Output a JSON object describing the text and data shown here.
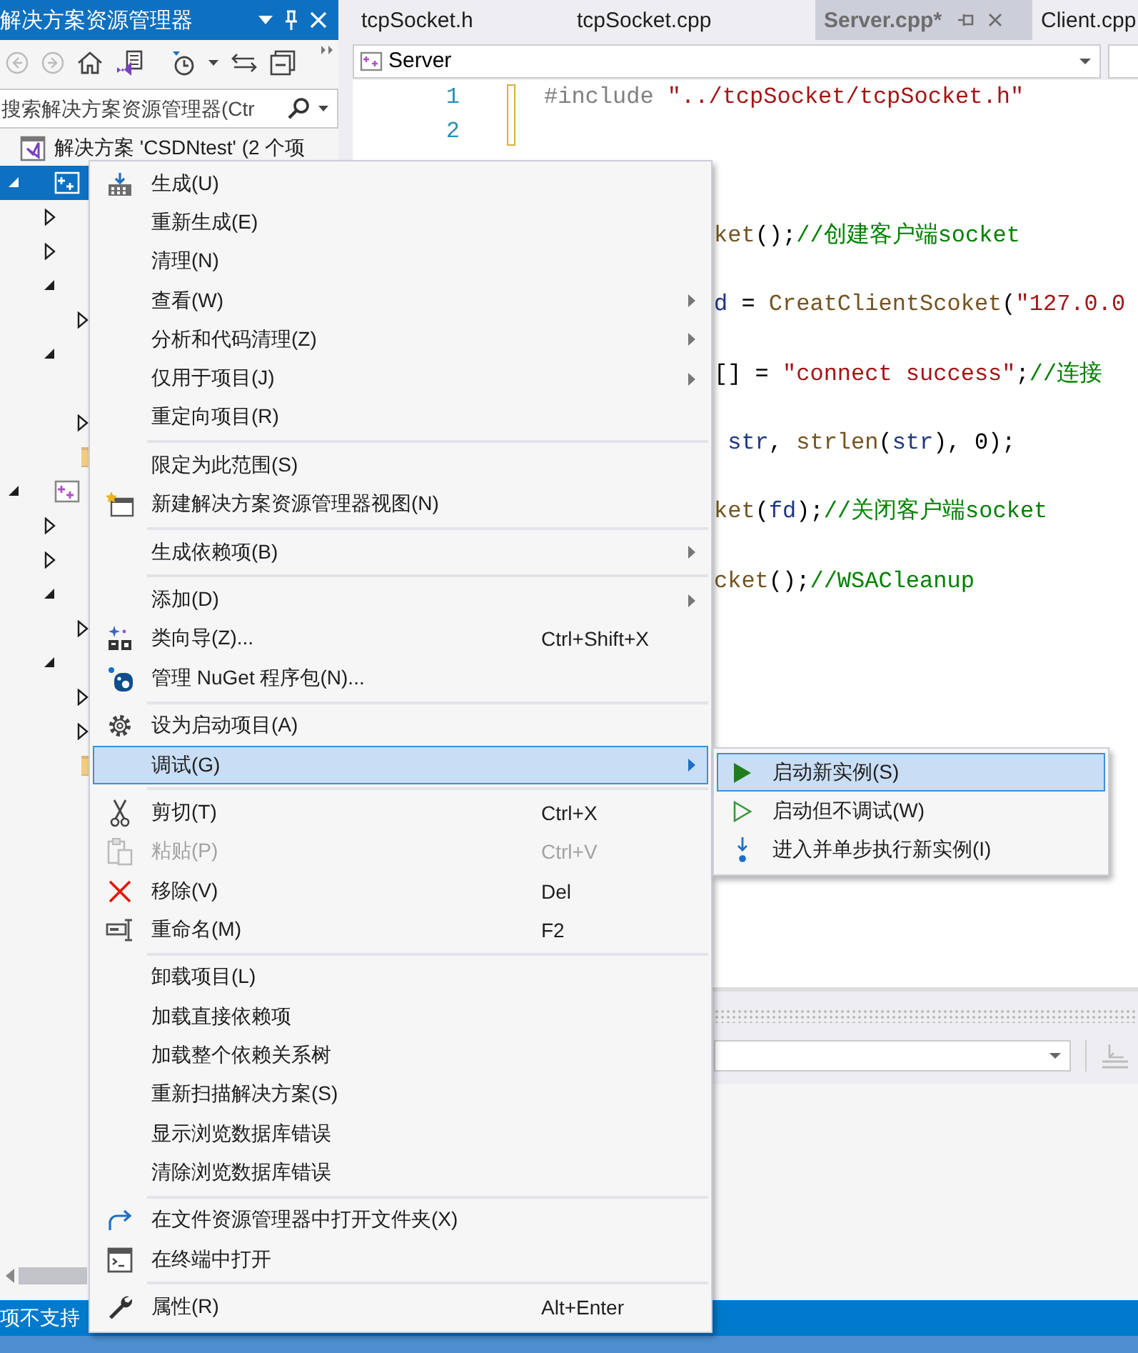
{
  "explorer": {
    "title": "解决方案资源管理器",
    "search": {
      "placeholder": "搜索解决方案资源管理器(Ctr"
    },
    "tree": [
      {
        "kind": "solution",
        "label": "解决方案 'CSDNtest' (2 个项",
        "children": [
          {
            "kind": "project",
            "expanded": true,
            "selected": true,
            "children": [
              {
                "kind": "node",
                "expanded": false
              },
              {
                "kind": "node",
                "expanded": false
              },
              {
                "kind": "node",
                "expanded": true,
                "children": [
                  {
                    "kind": "node",
                    "expanded": false
                  }
                ]
              },
              {
                "kind": "node",
                "expanded": true,
                "children": [
                  {
                    "kind": "file"
                  },
                  {
                    "kind": "node",
                    "expanded": false
                  }
                ]
              },
              {
                "kind": "folder"
              }
            ]
          },
          {
            "kind": "project",
            "expanded": true,
            "selected": false,
            "children": [
              {
                "kind": "node",
                "expanded": false
              },
              {
                "kind": "node",
                "expanded": false
              },
              {
                "kind": "node",
                "expanded": true,
                "children": [
                  {
                    "kind": "node",
                    "expanded": false
                  }
                ]
              },
              {
                "kind": "node",
                "expanded": true,
                "children": [
                  {
                    "kind": "node",
                    "expanded": false
                  },
                  {
                    "kind": "node",
                    "expanded": false
                  }
                ]
              },
              {
                "kind": "folder"
              }
            ]
          }
        ]
      }
    ]
  },
  "editor": {
    "tabs": [
      {
        "label": "tcpSocket.h",
        "selected": false
      },
      {
        "label": "tcpSocket.cpp",
        "selected": false
      },
      {
        "label": "Server.cpp*",
        "selected": true
      },
      {
        "label": "Client.cpp",
        "selected": false
      }
    ],
    "navigation": {
      "value": "Server"
    },
    "lines": [
      {
        "kind": "numbered",
        "number": "1",
        "tokens": [
          {
            "kind": "preprocessor",
            "text": "#include "
          },
          {
            "kind": "string",
            "text": "\"../tcpSocket/tcpSocket.h\""
          }
        ]
      },
      {
        "kind": "numbered",
        "number": "2"
      },
      {
        "kind": "fragment",
        "tokens": [
          {
            "kind": "function",
            "text": "ket"
          },
          {
            "kind": "plain",
            "text": "();"
          },
          {
            "kind": "comment",
            "text": "//创建客户端socket"
          }
        ]
      },
      {
        "kind": "fragment",
        "tokens": [
          {
            "kind": "variable",
            "text": "d"
          },
          {
            "kind": "plain",
            "text": " = "
          },
          {
            "kind": "function",
            "text": "CreatClientScoket"
          },
          {
            "kind": "plain",
            "text": "("
          },
          {
            "kind": "string",
            "text": "\"127.0.0"
          }
        ]
      },
      {
        "kind": "fragment",
        "tokens": [
          {
            "kind": "plain",
            "text": "[] = "
          },
          {
            "kind": "string",
            "text": "\"connect success\""
          },
          {
            "kind": "plain",
            "text": ";"
          },
          {
            "kind": "comment",
            "text": "//连接"
          }
        ]
      },
      {
        "kind": "fragment",
        "tokens": [
          {
            "kind": "variable",
            "text": " str"
          },
          {
            "kind": "plain",
            "text": ", "
          },
          {
            "kind": "function",
            "text": "strlen"
          },
          {
            "kind": "plain",
            "text": "("
          },
          {
            "kind": "variable",
            "text": "str"
          },
          {
            "kind": "plain",
            "text": "), 0);"
          }
        ]
      },
      {
        "kind": "fragment",
        "tokens": [
          {
            "kind": "function",
            "text": "ket"
          },
          {
            "kind": "plain",
            "text": "("
          },
          {
            "kind": "variable",
            "text": "fd"
          },
          {
            "kind": "plain",
            "text": ");"
          },
          {
            "kind": "comment",
            "text": "//关闭客户端socket"
          }
        ]
      },
      {
        "kind": "fragment",
        "tokens": [
          {
            "kind": "function",
            "text": "cket"
          },
          {
            "kind": "plain",
            "text": "();"
          },
          {
            "kind": "comment",
            "text": "//WSACleanup"
          }
        ]
      }
    ]
  },
  "menu": {
    "items": [
      {
        "kind": "item",
        "label": "生成(U)",
        "submenu": false,
        "disabled": false,
        "selected": false
      },
      {
        "kind": "item",
        "label": "重新生成(E)",
        "submenu": false,
        "disabled": false,
        "selected": false
      },
      {
        "kind": "item",
        "label": "清理(N)",
        "submenu": false,
        "disabled": false,
        "selected": false
      },
      {
        "kind": "item",
        "label": "查看(W)",
        "submenu": true,
        "disabled": false,
        "selected": false
      },
      {
        "kind": "item",
        "label": "分析和代码清理(Z)",
        "submenu": true,
        "disabled": false,
        "selected": false
      },
      {
        "kind": "item",
        "label": "仅用于项目(J)",
        "submenu": true,
        "disabled": false,
        "selected": false
      },
      {
        "kind": "item",
        "label": "重定向项目(R)",
        "submenu": false,
        "disabled": false,
        "selected": false
      },
      {
        "kind": "separator"
      },
      {
        "kind": "item",
        "label": "限定为此范围(S)",
        "submenu": false,
        "disabled": false,
        "selected": false
      },
      {
        "kind": "item",
        "label": "新建解决方案资源管理器视图(N)",
        "submenu": false,
        "disabled": false,
        "selected": false
      },
      {
        "kind": "separator"
      },
      {
        "kind": "item",
        "label": "生成依赖项(B)",
        "submenu": true,
        "disabled": false,
        "selected": false
      },
      {
        "kind": "separator"
      },
      {
        "kind": "item",
        "label": "添加(D)",
        "submenu": true,
        "disabled": false,
        "selected": false
      },
      {
        "kind": "item",
        "label": "类向导(Z)...",
        "shortcut": "Ctrl+Shift+X",
        "submenu": false,
        "disabled": false,
        "selected": false
      },
      {
        "kind": "item",
        "label": "管理 NuGet 程序包(N)...",
        "submenu": false,
        "disabled": false,
        "selected": false
      },
      {
        "kind": "separator"
      },
      {
        "kind": "item",
        "label": "设为启动项目(A)",
        "submenu": false,
        "disabled": false,
        "selected": false
      },
      {
        "kind": "item",
        "label": "调试(G)",
        "submenu": true,
        "disabled": false,
        "selected": true
      },
      {
        "kind": "separator"
      },
      {
        "kind": "item",
        "label": "剪切(T)",
        "shortcut": "Ctrl+X",
        "submenu": false,
        "disabled": false,
        "selected": false
      },
      {
        "kind": "item",
        "label": "粘贴(P)",
        "shortcut": "Ctrl+V",
        "submenu": false,
        "disabled": true,
        "selected": false
      },
      {
        "kind": "item",
        "label": "移除(V)",
        "shortcut": "Del",
        "submenu": false,
        "disabled": false,
        "selected": false
      },
      {
        "kind": "item",
        "label": "重命名(M)",
        "shortcut": "F2",
        "submenu": false,
        "disabled": false,
        "selected": false
      },
      {
        "kind": "separator"
      },
      {
        "kind": "item",
        "label": "卸载项目(L)",
        "submenu": false,
        "disabled": false,
        "selected": false
      },
      {
        "kind": "item",
        "label": "加载直接依赖项",
        "submenu": false,
        "disabled": false,
        "selected": false
      },
      {
        "kind": "item",
        "label": "加载整个依赖关系树",
        "submenu": false,
        "disabled": false,
        "selected": false
      },
      {
        "kind": "item",
        "label": "重新扫描解决方案(S)",
        "submenu": false,
        "disabled": false,
        "selected": false
      },
      {
        "kind": "item",
        "label": "显示浏览数据库错误",
        "submenu": false,
        "disabled": false,
        "selected": false
      },
      {
        "kind": "item",
        "label": "清除浏览数据库错误",
        "submenu": false,
        "disabled": false,
        "selected": false
      },
      {
        "kind": "separator"
      },
      {
        "kind": "item",
        "label": "在文件资源管理器中打开文件夹(X)",
        "submenu": false,
        "disabled": false,
        "selected": false
      },
      {
        "kind": "item",
        "label": "在终端中打开",
        "submenu": false,
        "disabled": false,
        "selected": false
      },
      {
        "kind": "separator"
      },
      {
        "kind": "item",
        "label": "属性(R)",
        "shortcut": "Alt+Enter",
        "submenu": false,
        "disabled": false,
        "selected": false
      }
    ]
  },
  "submenu": {
    "items": [
      {
        "label": "启动新实例(S)",
        "selected": true
      },
      {
        "label": "启动但不调试(W)",
        "selected": false
      },
      {
        "label": "进入并单步执行新实例(I)",
        "selected": false
      }
    ]
  },
  "status_bar": {
    "text": "项不支持"
  }
}
